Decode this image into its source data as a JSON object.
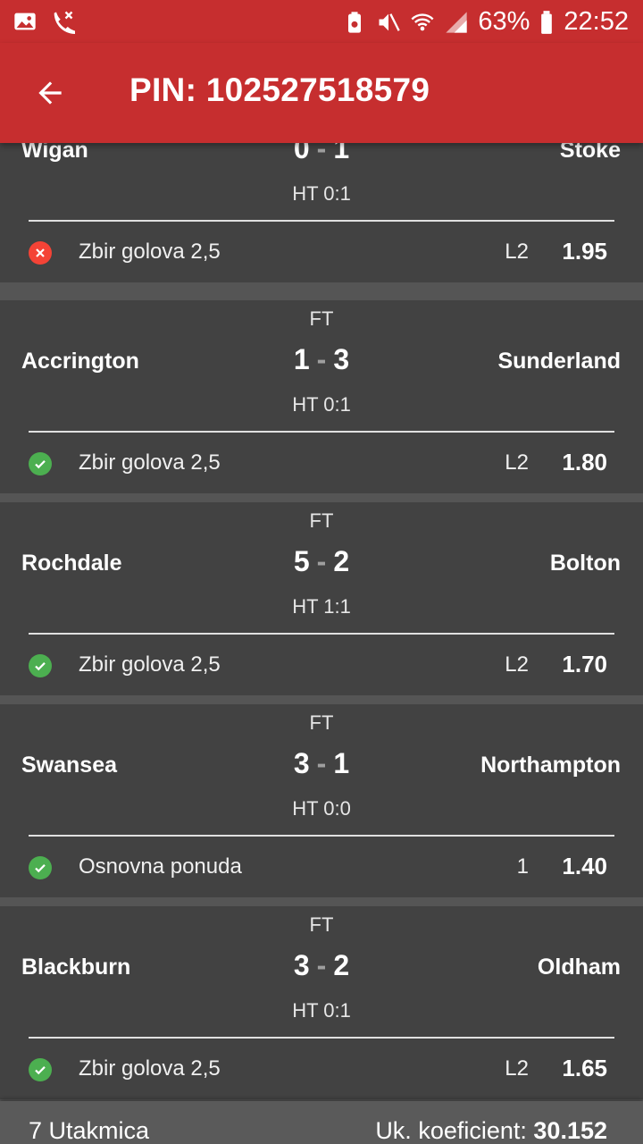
{
  "status_bar": {
    "battery": "63%",
    "time": "22:52",
    "icons": [
      "image-icon",
      "missed-call-icon",
      "battery-saver-icon",
      "mute-icon",
      "wifi-icon",
      "signal-icon",
      "battery-icon"
    ]
  },
  "header": {
    "title": "PIN: 102527518579",
    "back_icon": "arrow-back-icon"
  },
  "colors": {
    "accent": "#c62e2f",
    "card": "#424242",
    "win": "#4caf50",
    "lose": "#f44336"
  },
  "matches": [
    {
      "status": "",
      "home": "Wigan",
      "away": "Stoke",
      "home_score": "0",
      "away_score": "1",
      "ht": "HT 0:1",
      "result": "lose",
      "market": "Zbir golova 2,5",
      "pick": "L2",
      "odd": "1.95"
    },
    {
      "status": "FT",
      "home": "Accrington",
      "away": "Sunderland",
      "home_score": "1",
      "away_score": "3",
      "ht": "HT 0:1",
      "result": "win",
      "market": "Zbir golova 2,5",
      "pick": "L2",
      "odd": "1.80"
    },
    {
      "status": "FT",
      "home": "Rochdale",
      "away": "Bolton",
      "home_score": "5",
      "away_score": "2",
      "ht": "HT 1:1",
      "result": "win",
      "market": "Zbir golova 2,5",
      "pick": "L2",
      "odd": "1.70"
    },
    {
      "status": "FT",
      "home": "Swansea",
      "away": "Northampton",
      "home_score": "3",
      "away_score": "1",
      "ht": "HT 0:0",
      "result": "win",
      "market": "Osnovna ponuda",
      "pick": "1",
      "odd": "1.40"
    },
    {
      "status": "FT",
      "home": "Blackburn",
      "away": "Oldham",
      "home_score": "3",
      "away_score": "2",
      "ht": "HT 0:1",
      "result": "win",
      "market": "Zbir golova 2,5",
      "pick": "L2",
      "odd": "1.65"
    }
  ],
  "footer": {
    "count": "7 Utakmica",
    "total_label": "Uk. koeficient:",
    "total_value": "30.152"
  }
}
